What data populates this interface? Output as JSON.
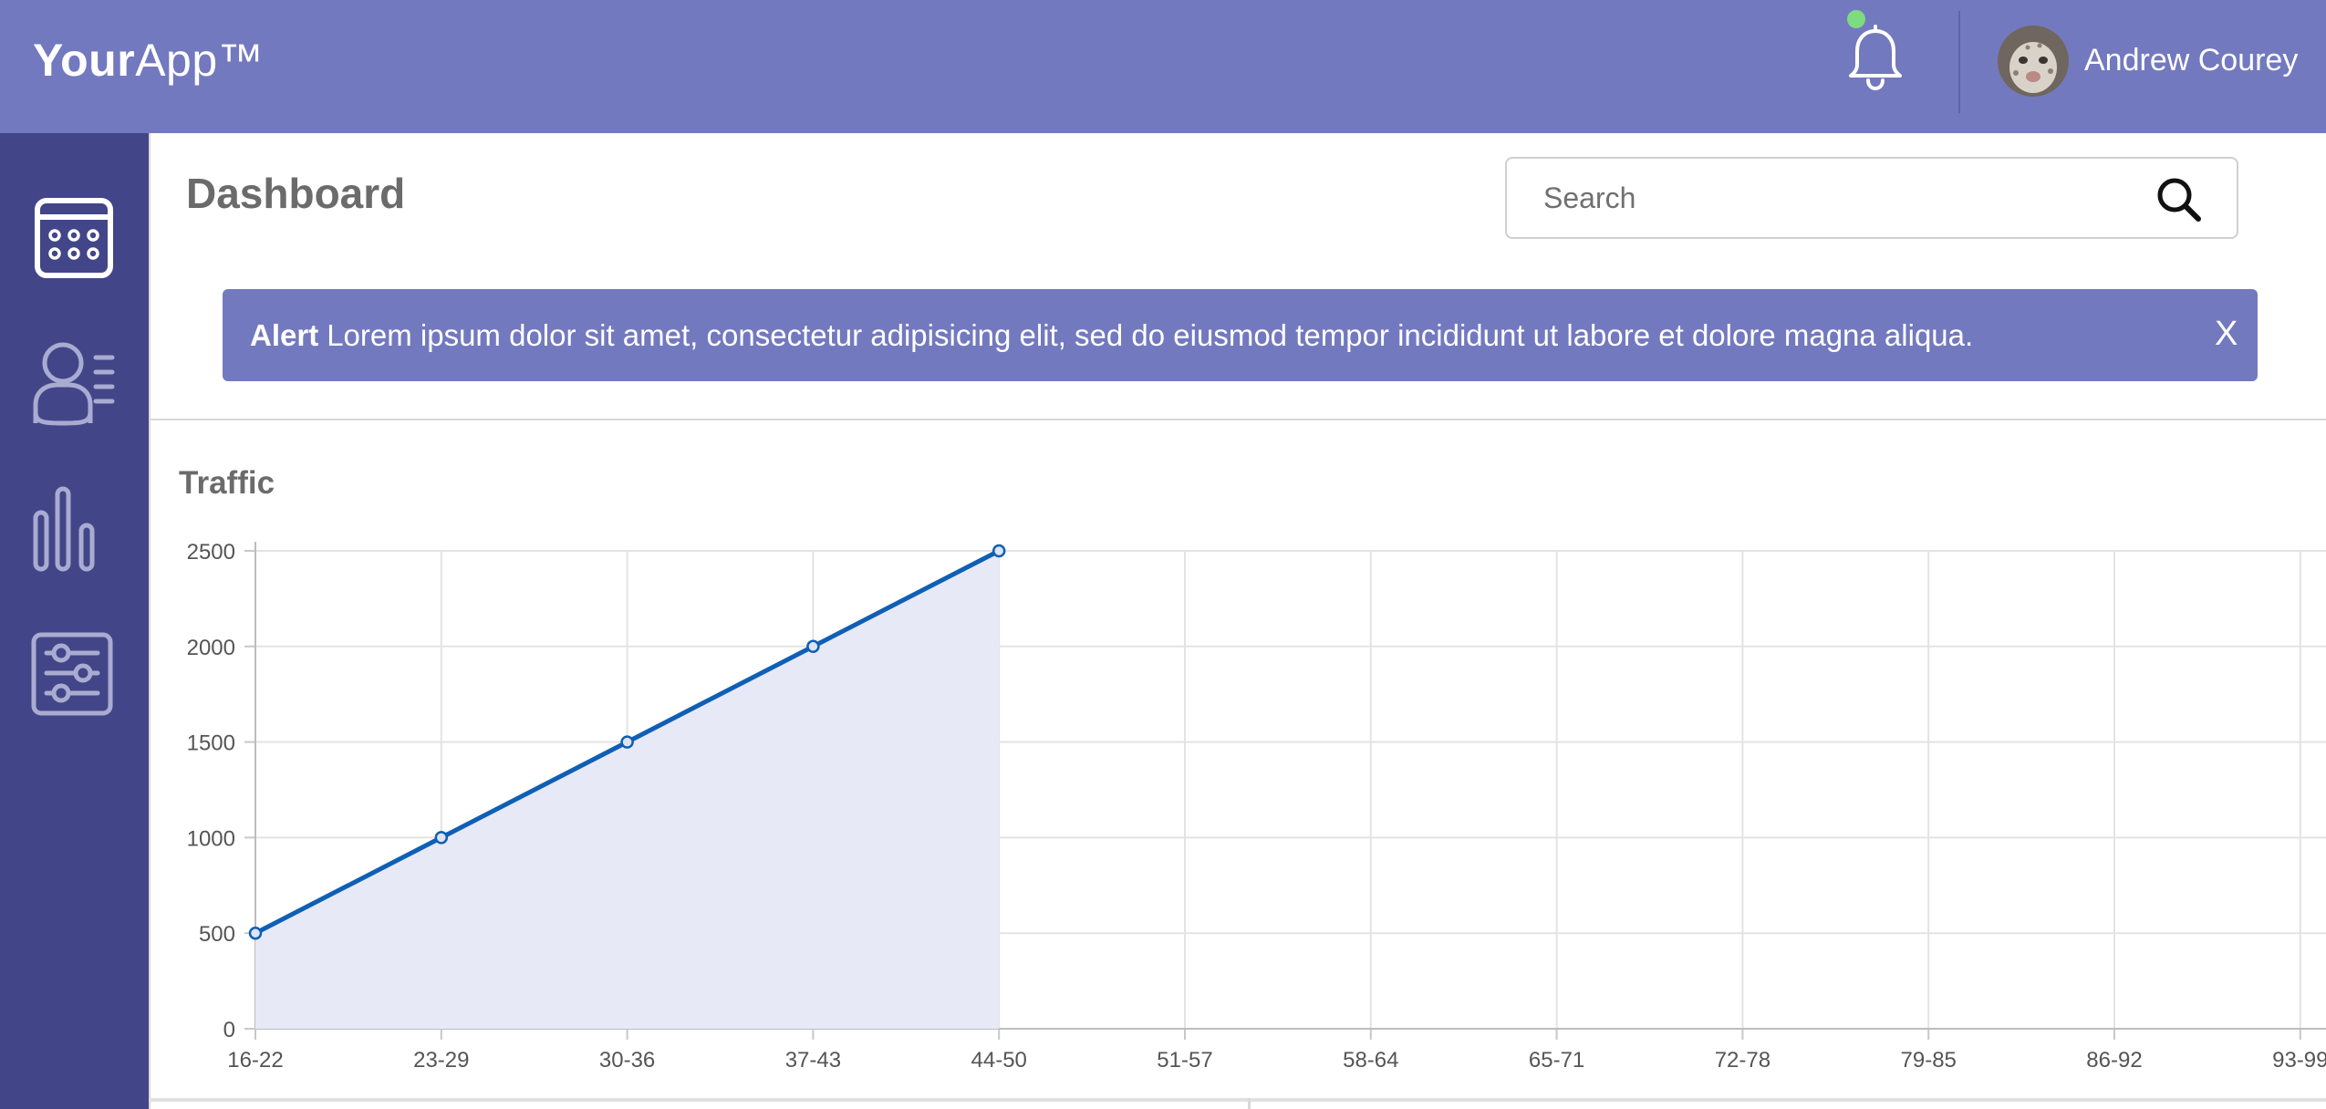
{
  "app": {
    "logo_bold": "Your",
    "logo_rest": "App™"
  },
  "header": {
    "user_name": "Andrew Courey",
    "notification_icon": "bell-icon",
    "notification_status_color": "#7ddc7f"
  },
  "sidebar": {
    "items": [
      {
        "icon": "calendar-icon"
      },
      {
        "icon": "user-list-icon"
      },
      {
        "icon": "bar-chart-icon"
      },
      {
        "icon": "sliders-icon"
      }
    ]
  },
  "main": {
    "title": "Dashboard",
    "search": {
      "placeholder": "Search",
      "value": "",
      "icon": "search-icon"
    }
  },
  "alert": {
    "title": "Alert",
    "message": "Lorem ipsum dolor sit amet, consectetur adipisicing elit, sed do eiusmod tempor incididunt ut labore et dolore magna aliqua.",
    "close_label": "X"
  },
  "traffic": {
    "title": "Traffic"
  },
  "colors": {
    "header": "#7379bf",
    "sidebar": "#424688",
    "alert": "#7379bf",
    "line": "#0f5fb5",
    "area_fill": "#e8e9f6"
  },
  "chart_data": {
    "type": "area",
    "title": "Traffic",
    "categories": [
      "16-22",
      "23-29",
      "30-36",
      "37-43",
      "44-50",
      "51-57",
      "58-64",
      "65-71",
      "72-78",
      "79-85",
      "86-92",
      "93-99"
    ],
    "series": [
      {
        "values": [
          500,
          1000,
          1500,
          2000,
          2500
        ]
      }
    ],
    "ylim": [
      0,
      2500
    ],
    "yticks": [
      0,
      500,
      1000,
      1500,
      2000,
      2500
    ],
    "grid": true
  }
}
